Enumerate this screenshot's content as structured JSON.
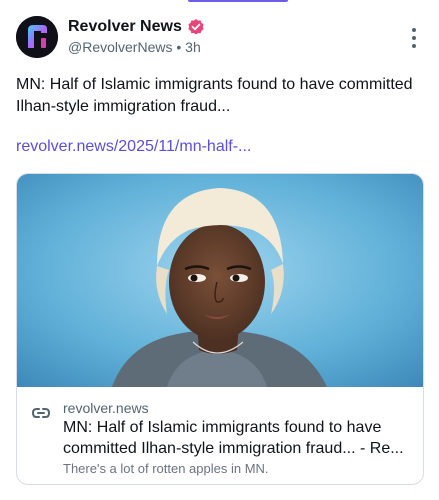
{
  "author": {
    "display_name": "Revolver News",
    "handle": "@RevolverNews",
    "separator": "•",
    "time": "3h",
    "avatar_letter": "r",
    "verified_color": "#e8457a"
  },
  "post": {
    "text": "MN: Half of Islamic immigrants found to have committed Ilhan-style immigration fraud...",
    "link_text": "revolver.news/2025/11/mn-half-..."
  },
  "link_card": {
    "domain": "revolver.news",
    "title": "MN: Half of Islamic immigrants found to have committed Ilhan-style immigration fraud... - Re...",
    "description": "There's a lot of rotten apples in MN.",
    "icon": "link-icon"
  },
  "icons": {
    "more": "more-vertical-icon",
    "verified": "verified-badge-icon"
  },
  "colors": {
    "accent": "#5b4fd6",
    "secondary_text": "#536471"
  }
}
